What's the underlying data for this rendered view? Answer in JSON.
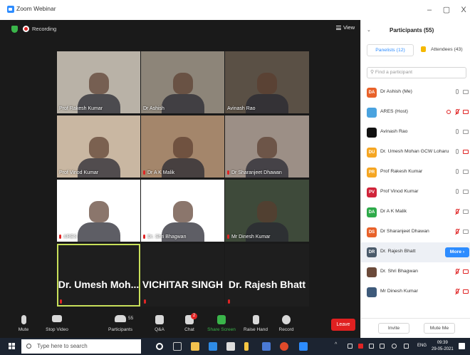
{
  "window": {
    "title": "Zoom Webinar",
    "minimize_glyph": "–",
    "restore_glyph": "▢",
    "close_glyph": "X"
  },
  "meeting": {
    "recording_label": "Recording",
    "view_label": "View",
    "tiles": [
      {
        "name": "Prof Rakesh Kumar",
        "muted": false,
        "bg": "#b9b2a7"
      },
      {
        "name": "Dr Ashish",
        "muted": false,
        "bg": "#8d8579"
      },
      {
        "name": "Avinash Rao",
        "muted": false,
        "bg": "#5a5045"
      },
      {
        "name": "Prof Vinod Kumar",
        "muted": false,
        "bg": "#c9b7a2"
      },
      {
        "name": "Dr A K Malik",
        "muted": true,
        "bg": "#a4866b"
      },
      {
        "name": "Dr Sharanjeet Dhawan",
        "muted": true,
        "bg": "#9c8f86"
      },
      {
        "name": "ARES",
        "muted": true,
        "bg": "#ffffff"
      },
      {
        "name": "Dr. Shri Bhagwan",
        "muted": true,
        "bg": "#ffffff"
      },
      {
        "name": "Mr Dinesh Kumar",
        "muted": true,
        "bg": "#3e4a3a"
      }
    ],
    "name_tiles": [
      {
        "display": "Dr. Umesh Moh...",
        "active": true
      },
      {
        "display": "VICHITAR SINGH",
        "active": false
      },
      {
        "display": "Dr. Rajesh Bhatt",
        "active": false
      }
    ]
  },
  "toolbar": {
    "mute": "Mute",
    "stop_video": "Stop Video",
    "participants": "Participants",
    "participants_count": "55",
    "qa": "Q&A",
    "chat": "Chat",
    "chat_badge": "2",
    "share_screen": "Share Screen",
    "raise_hand": "Raise Hand",
    "record": "Record",
    "leave": "Leave",
    "accent_green": "#3ab54a",
    "leave_color": "#e02020"
  },
  "panel": {
    "title": "Participants (55)",
    "tab_panelists": "Panelists (12)",
    "tab_attendees": "Attendees (43)",
    "search_placeholder": "Find a participant",
    "more_label": "More ›",
    "invite": "Invite",
    "mute_me": "Mute Me",
    "participants": [
      {
        "initials": "DA",
        "color": "#e8622a",
        "name": "Dr Ashish (Me)",
        "mic": "on",
        "cam": "on",
        "recording": false
      },
      {
        "initials": "",
        "color": "#4aa3df",
        "name": "ARES (Host)",
        "mic": "muted",
        "cam": "off",
        "recording": true
      },
      {
        "initials": "",
        "color": "#111111",
        "name": "Avinash Rao",
        "mic": "on",
        "cam": "on",
        "recording": false
      },
      {
        "initials": "DU",
        "color": "#f5a623",
        "name": "Dr. Umesh Mohan GCW Loharu",
        "mic": "on",
        "cam": "off",
        "recording": false
      },
      {
        "initials": "PR",
        "color": "#f5a623",
        "name": "Prof Rakesh Kumar",
        "mic": "on",
        "cam": "on",
        "recording": false
      },
      {
        "initials": "PV",
        "color": "#d0243a",
        "name": "Prof Vinod Kumar",
        "mic": "on",
        "cam": "on",
        "recording": false
      },
      {
        "initials": "DA",
        "color": "#2eaa4a",
        "name": "Dr A K Malik",
        "mic": "muted",
        "cam": "on",
        "recording": false
      },
      {
        "initials": "DS",
        "color": "#e8622a",
        "name": "Dr Sharanjeet Dhawan",
        "mic": "muted",
        "cam": "on",
        "recording": false
      },
      {
        "initials": "DR",
        "color": "#4a5a6a",
        "name": "Dr. Rajesh Bhatt",
        "mic": "on",
        "cam": "on",
        "recording": false
      },
      {
        "initials": "",
        "color": "#6b4a3a",
        "name": "Dr. Shri Bhagwan",
        "mic": "muted",
        "cam": "off",
        "recording": false
      },
      {
        "initials": "",
        "color": "#3e5a7a",
        "name": "Mr Dinesh Kumar",
        "mic": "muted",
        "cam": "off",
        "recording": false
      }
    ]
  },
  "taskbar": {
    "search_placeholder": "Type here to search",
    "lang": "ENG",
    "time": "09:39",
    "date": "29-05-2021"
  }
}
